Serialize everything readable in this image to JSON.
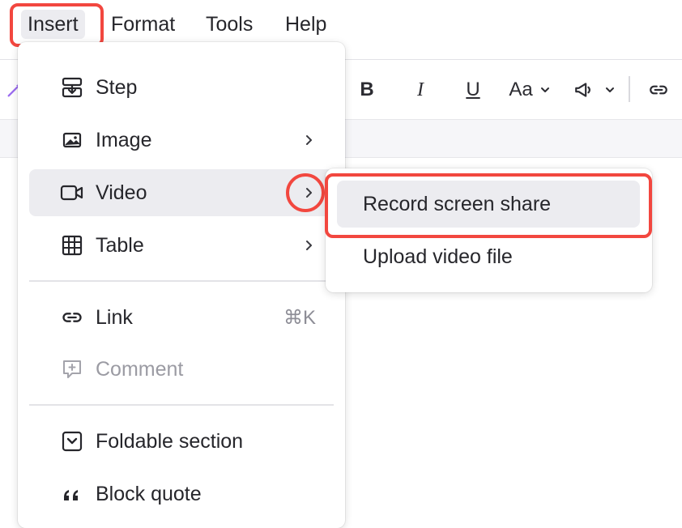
{
  "menubar": {
    "items": [
      {
        "label": "Insert",
        "active": true
      },
      {
        "label": "Format"
      },
      {
        "label": "Tools"
      },
      {
        "label": "Help"
      }
    ]
  },
  "toolbar": {
    "bold_label": "B",
    "italic_label": "I",
    "underline_label": "U",
    "font_label": "Aa"
  },
  "insert_menu": {
    "items": [
      {
        "label": "Step",
        "icon": "step-icon"
      },
      {
        "label": "Image",
        "icon": "image-icon",
        "has_submenu": true
      },
      {
        "label": "Video",
        "icon": "video-icon",
        "has_submenu": true,
        "hovered": true
      },
      {
        "label": "Table",
        "icon": "table-icon",
        "has_submenu": true
      },
      {
        "label": "Link",
        "icon": "link-icon",
        "shortcut": "⌘K"
      },
      {
        "label": "Comment",
        "icon": "comment-icon",
        "disabled": true
      },
      {
        "label": "Foldable section",
        "icon": "foldable-section-icon"
      },
      {
        "label": "Block quote",
        "icon": "quote-icon"
      }
    ]
  },
  "video_submenu": {
    "items": [
      {
        "label": "Record screen share",
        "hovered": true
      },
      {
        "label": "Upload video file"
      }
    ]
  },
  "colors": {
    "highlight": "#f2473f",
    "hover_bg": "#ececf0",
    "text": "#26262b"
  }
}
